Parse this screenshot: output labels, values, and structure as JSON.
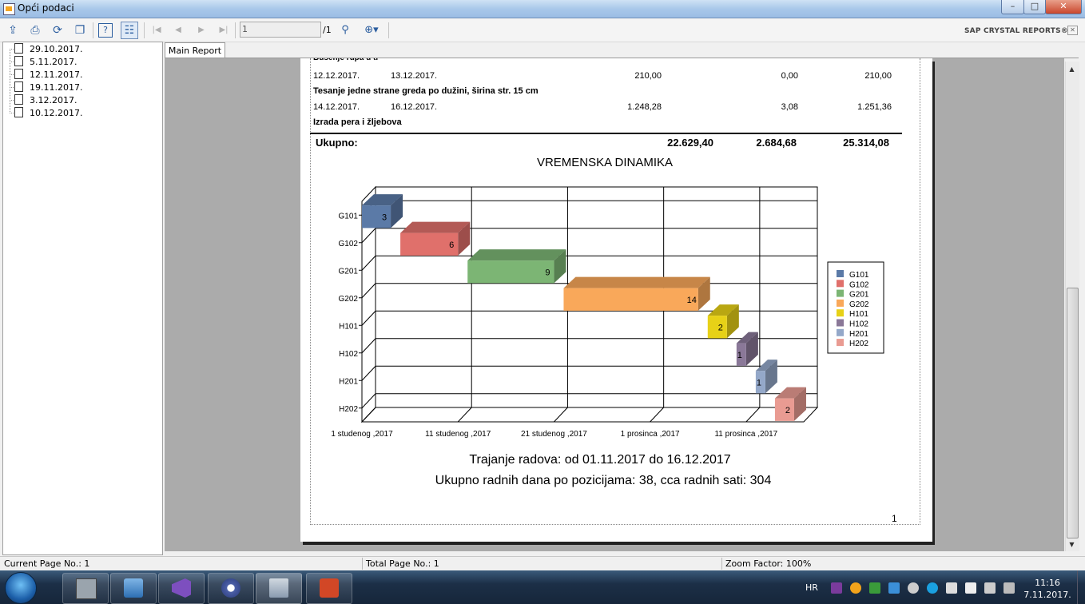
{
  "window": {
    "title": "Opći podaci",
    "minimize": "–",
    "maximize": "□",
    "close": "✕"
  },
  "toolbar": {
    "page_value": "1",
    "page_total": "/1",
    "brand": "SAP CRYSTAL REPORTS®",
    "brand_close": "✕",
    "icons": [
      "export-icon",
      "print-icon",
      "refresh-icon",
      "copy-icon",
      "help-icon",
      "group-tree-icon",
      "first-page-icon",
      "prev-page-icon",
      "next-page-icon",
      "last-page-icon",
      "find-icon",
      "zoom-icon"
    ]
  },
  "tree": {
    "items": [
      "29.10.2017.",
      "5.11.2017.",
      "12.11.2017.",
      "19.11.2017.",
      "3.12.2017.",
      "10.12.2017."
    ]
  },
  "tabs": {
    "main": "Main Report"
  },
  "report": {
    "cut_line": "Bušenje rupa u tl",
    "rows": [
      {
        "start": "12.12.2017.",
        "end": "13.12.2017.",
        "v1": "210,00",
        "v2": "0,00",
        "v3": "210,00"
      },
      {
        "desc": "Tesanje jedne strane greda po dužini, širina str. 15 cm"
      },
      {
        "start": "14.12.2017.",
        "end": "16.12.2017.",
        "v1": "1.248,28",
        "v2": "3,08",
        "v3": "1.251,36"
      },
      {
        "desc": "Izrada pera i žljebova"
      }
    ],
    "total_label": "Ukupno:",
    "total_v1": "22.629,40",
    "total_v2": "2.684,68",
    "total_v3": "25.314,08",
    "footer_line1": "Trajanje radova: od 01.11.2017 do 16.12.2017",
    "footer_line2": "Ukupno radnih dana po pozicijama: 38, cca radnih sati: 304",
    "page_number": "1"
  },
  "chart_data": {
    "type": "bar",
    "orientation": "horizontal-gantt-3d",
    "title": "VREMENSKA DINAMIKA",
    "x_ticks": [
      "1 studenog ,2017",
      "11 studenog ,2017",
      "21 studenog ,2017",
      "1 prosinca ,2017",
      "11 prosinca ,2017"
    ],
    "x_tick_day_offsets": [
      0,
      10,
      20,
      30,
      40
    ],
    "categories": [
      "G101",
      "G102",
      "G201",
      "G202",
      "H101",
      "H102",
      "H201",
      "H202"
    ],
    "series": [
      {
        "name": "G101",
        "start_day": 0,
        "duration": 3,
        "label": "3",
        "color": "#5b7aa7"
      },
      {
        "name": "G102",
        "start_day": 4,
        "duration": 6,
        "label": "6",
        "color": "#e0706b"
      },
      {
        "name": "G201",
        "start_day": 11,
        "duration": 9,
        "label": "9",
        "color": "#7cb574"
      },
      {
        "name": "G202",
        "start_day": 21,
        "duration": 14,
        "label": "14",
        "color": "#f9a85a"
      },
      {
        "name": "H101",
        "start_day": 36,
        "duration": 2,
        "label": "2",
        "color": "#e7d117"
      },
      {
        "name": "H102",
        "start_day": 39,
        "duration": 1,
        "label": "1",
        "color": "#8a7898"
      },
      {
        "name": "H201",
        "start_day": 41,
        "duration": 1,
        "label": "1",
        "color": "#94a8c9"
      },
      {
        "name": "H202",
        "start_day": 43,
        "duration": 2,
        "label": "2",
        "color": "#e99b92"
      }
    ],
    "x_range_days": [
      0,
      46
    ],
    "grid": true,
    "legend": "right"
  },
  "status": {
    "current_page": "Current Page No.: 1",
    "total_page": "Total Page No.: 1",
    "zoom": "Zoom Factor: 100%"
  },
  "taskbar": {
    "apps": [
      "media-center-icon",
      "remote-desktop-icon",
      "visual-studio-icon",
      "bittorrent-icon",
      "installer-icon",
      "powerpoint-icon"
    ],
    "lang": "HR",
    "time": "11:16",
    "date": "7.11.2017."
  }
}
